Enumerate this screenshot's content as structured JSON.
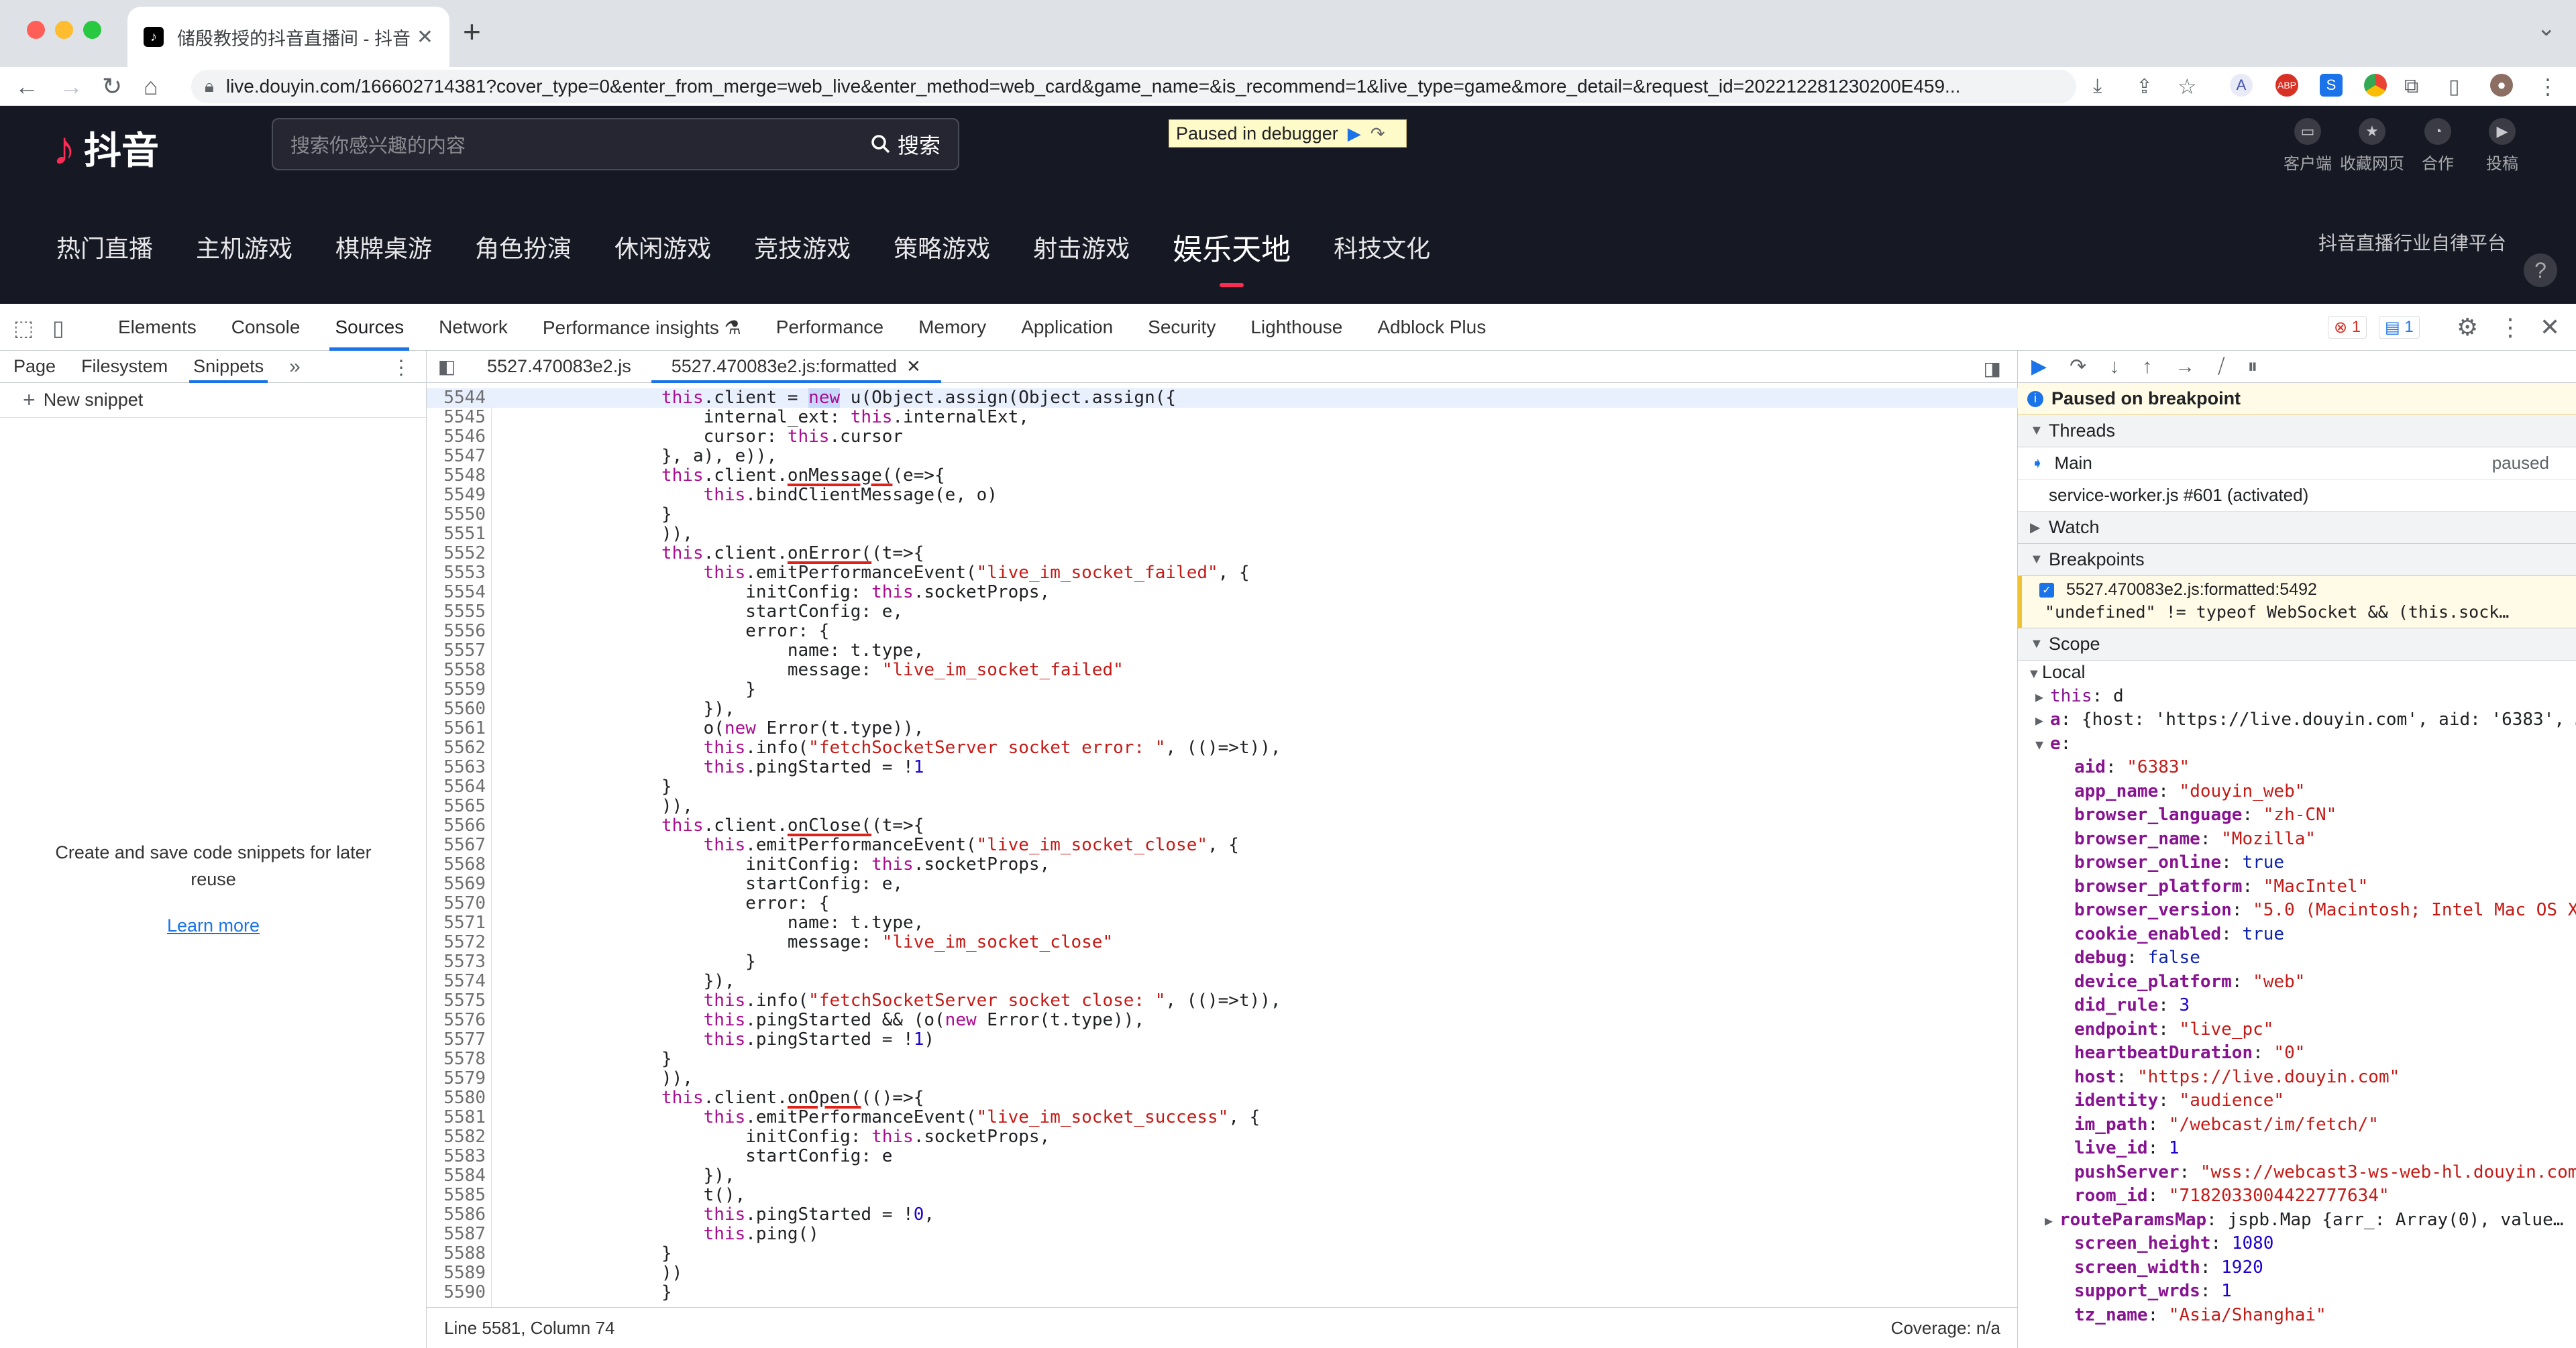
{
  "browser": {
    "tab_title": "储殷教授的抖音直播间 - 抖音直",
    "tab_close": "✕",
    "new_tab": "+",
    "url": "live.douyin.com/166602714381?cover_type=0&enter_from_merge=web_live&enter_method=web_card&game_name=&is_recommend=1&live_type=game&more_detail=&request_id=20221228123020​0E459..."
  },
  "douyin": {
    "logo_text": "抖音",
    "search_placeholder": "搜索你感兴趣的内容",
    "search_button": "搜索",
    "debugger_banner": "Paused in debugger",
    "top_tools": [
      {
        "label": "客户端",
        "icon": "monitor-icon"
      },
      {
        "label": "收藏网页",
        "icon": "star-icon"
      },
      {
        "label": "合作",
        "icon": "handshake-icon"
      },
      {
        "label": "投稿",
        "icon": "upload-icon"
      }
    ],
    "categories": [
      "热门直播",
      "主机游戏",
      "棋牌桌游",
      "角色扮演",
      "休闲游戏",
      "竞技游戏",
      "策略游戏",
      "射击游戏",
      "娱乐天地",
      "科技文化"
    ],
    "active_category": "娱乐天地",
    "right_link": "抖音直播行业自律平台",
    "help": "?"
  },
  "devtools": {
    "tabs": [
      "Elements",
      "Console",
      "Sources",
      "Network",
      "Performance insights ⚗",
      "Performance",
      "Memory",
      "Application",
      "Security",
      "Lighthouse",
      "Adblock Plus"
    ],
    "active_tab": "Sources",
    "error_count": "1",
    "message_count": "1",
    "left_tabs": [
      "Page",
      "Filesystem",
      "Snippets"
    ],
    "left_more": "»",
    "new_snippet": "New snippet",
    "empty_text": "Create and save code snippets for later reuse",
    "learn_more": "Learn more",
    "editor_tabs": [
      "5527.470083e2.js",
      "5527.470083e2.js:formatted"
    ],
    "status_left": "Line 5581, Column 74",
    "status_right": "Coverage: n/a",
    "paused_notice": "Paused on breakpoint",
    "threads_header": "Threads",
    "thread_main": "Main",
    "thread_main_state": "paused",
    "thread_worker": "service-worker.js #601 (activated)",
    "watch_header": "Watch",
    "breakpoints_header": "Breakpoints",
    "breakpoint_file": "5527.470083e2.js:formatted:5492",
    "breakpoint_code": "\"undefined\" != typeof WebSocket && (this.sock…",
    "scope_header": "Scope",
    "local_header": "Local"
  },
  "code_lines": [
    {
      "num": "5544",
      "html": "<span class=\"k\">this</span>.client = <span class=\"k hl\">new</span> u(Object.assign(Object.assign({"
    },
    {
      "num": "5545",
      "html": "    internal_ext: <span class=\"k\">this</span>.internalExt,"
    },
    {
      "num": "5546",
      "html": "    cursor: <span class=\"k\">this</span>.cursor"
    },
    {
      "num": "5547",
      "html": "}, a), e)),"
    },
    {
      "num": "5548",
      "html": "<span class=\"k\">this</span>.client.<span class=\"ul\">onMessage(</span>(e=>{"
    },
    {
      "num": "5549",
      "html": "    <span class=\"k\">this</span>.bindClientMessage(e, o)"
    },
    {
      "num": "5550",
      "html": "}"
    },
    {
      "num": "5551",
      "html": ")),"
    },
    {
      "num": "5552",
      "html": "<span class=\"k\">this</span>.client.<span class=\"ul\">onError(</span>(t=>{"
    },
    {
      "num": "5553",
      "html": "    <span class=\"k\">this</span>.emitPerformanceEvent(<span class=\"s\">\"live_im_socket_failed\"</span>, {"
    },
    {
      "num": "5554",
      "html": "        initConfig: <span class=\"k\">this</span>.socketProps,"
    },
    {
      "num": "5555",
      "html": "        startConfig: e,"
    },
    {
      "num": "5556",
      "html": "        error: {"
    },
    {
      "num": "5557",
      "html": "            name: t.type,"
    },
    {
      "num": "5558",
      "html": "            message: <span class=\"s\">\"live_im_socket_failed\"</span>"
    },
    {
      "num": "5559",
      "html": "        }"
    },
    {
      "num": "5560",
      "html": "    }),"
    },
    {
      "num": "5561",
      "html": "    o(<span class=\"k\">new</span> Error(t.type)),"
    },
    {
      "num": "5562",
      "html": "    <span class=\"k\">this</span>.info(<span class=\"s\">\"fetchSocketServer socket error: \"</span>, (()=>t)),"
    },
    {
      "num": "5563",
      "html": "    <span class=\"k\">this</span>.pingStarted = !<span class=\"n\">1</span>"
    },
    {
      "num": "5564",
      "html": "}"
    },
    {
      "num": "5565",
      "html": ")),"
    },
    {
      "num": "5566",
      "html": "<span class=\"k\">this</span>.client.<span class=\"ul\">onClose(</span>(t=>{"
    },
    {
      "num": "5567",
      "html": "    <span class=\"k\">this</span>.emitPerformanceEvent(<span class=\"s\">\"live_im_socket_close\"</span>, {"
    },
    {
      "num": "5568",
      "html": "        initConfig: <span class=\"k\">this</span>.socketProps,"
    },
    {
      "num": "5569",
      "html": "        startConfig: e,"
    },
    {
      "num": "5570",
      "html": "        error: {"
    },
    {
      "num": "5571",
      "html": "            name: t.type,"
    },
    {
      "num": "5572",
      "html": "            message: <span class=\"s\">\"live_im_socket_close\"</span>"
    },
    {
      "num": "5573",
      "html": "        }"
    },
    {
      "num": "5574",
      "html": "    }),"
    },
    {
      "num": "5575",
      "html": "    <span class=\"k\">this</span>.info(<span class=\"s\">\"fetchSocketServer socket close: \"</span>, (()=>t)),"
    },
    {
      "num": "5576",
      "html": "    <span class=\"k\">this</span>.pingStarted &amp;&amp; (o(<span class=\"k\">new</span> Error(t.type)),"
    },
    {
      "num": "5577",
      "html": "    <span class=\"k\">this</span>.pingStarted = !<span class=\"n\">1</span>)"
    },
    {
      "num": "5578",
      "html": "}"
    },
    {
      "num": "5579",
      "html": ")),"
    },
    {
      "num": "5580",
      "html": "<span class=\"k\">this</span>.client.<span class=\"ul\">onOpen(</span>(()=>{"
    },
    {
      "num": "5581",
      "html": "    <span class=\"k\">this</span>.emitPerformanceEvent(<span class=\"s\">\"live_im_socket_success\"</span>, {"
    },
    {
      "num": "5582",
      "html": "        initConfig: <span class=\"k\">this</span>.socketProps,"
    },
    {
      "num": "5583",
      "html": "        startConfig: e"
    },
    {
      "num": "5584",
      "html": "    }),"
    },
    {
      "num": "5585",
      "html": "    t(),"
    },
    {
      "num": "5586",
      "html": "    <span class=\"k\">this</span>.pingStarted = !<span class=\"n\">0</span>,"
    },
    {
      "num": "5587",
      "html": "    <span class=\"k\">this</span>.ping()"
    },
    {
      "num": "5588",
      "html": "}"
    },
    {
      "num": "5589",
      "html": "))"
    },
    {
      "num": "5590",
      "html": "}"
    }
  ],
  "scope_lines": [
    {
      "tri": "▶",
      "key": "this",
      "val": "d",
      "cls": "vo"
    },
    {
      "tri": "▶",
      "key": "a",
      "val": "{host: 'https://live.douyin.com', aid: '6383', …}",
      "cls": "vo"
    },
    {
      "tri": "▼",
      "key": "e",
      "val": "",
      "cls": "vo"
    },
    {
      "tri": "",
      "key": "aid",
      "val": "\"6383\"",
      "cls": "vs"
    },
    {
      "tri": "",
      "key": "app_name",
      "val": "\"douyin_web\"",
      "cls": "vs"
    },
    {
      "tri": "",
      "key": "browser_language",
      "val": "\"zh-CN\"",
      "cls": "vs"
    },
    {
      "tri": "",
      "key": "browser_name",
      "val": "\"Mozilla\"",
      "cls": "vs"
    },
    {
      "tri": "",
      "key": "browser_online",
      "val": "true",
      "cls": "vk"
    },
    {
      "tri": "",
      "key": "browser_platform",
      "val": "\"MacIntel\"",
      "cls": "vs"
    },
    {
      "tri": "",
      "key": "browser_version",
      "val": "\"5.0 (Macintosh; Intel Mac OS X…",
      "cls": "vs"
    },
    {
      "tri": "",
      "key": "cookie_enabled",
      "val": "true",
      "cls": "vk"
    },
    {
      "tri": "",
      "key": "debug",
      "val": "false",
      "cls": "vk"
    },
    {
      "tri": "",
      "key": "device_platform",
      "val": "\"web\"",
      "cls": "vs"
    },
    {
      "tri": "",
      "key": "did_rule",
      "val": "3",
      "cls": "vn"
    },
    {
      "tri": "",
      "key": "endpoint",
      "val": "\"live_pc\"",
      "cls": "vs"
    },
    {
      "tri": "",
      "key": "heartbeatDuration",
      "val": "\"0\"",
      "cls": "vs"
    },
    {
      "tri": "",
      "key": "host",
      "val": "\"https://live.douyin.com\"",
      "cls": "vs"
    },
    {
      "tri": "",
      "key": "identity",
      "val": "\"audience\"",
      "cls": "vs"
    },
    {
      "tri": "",
      "key": "im_path",
      "val": "\"/webcast/im/fetch/\"",
      "cls": "vs"
    },
    {
      "tri": "",
      "key": "live_id",
      "val": "1",
      "cls": "vn"
    },
    {
      "tri": "",
      "key": "pushServer",
      "val": "\"wss://webcast3-ws-web-hl.douyin.com…",
      "cls": "vs"
    },
    {
      "tri": "",
      "key": "room_id",
      "val": "\"7182033004422777634\"",
      "cls": "vs"
    },
    {
      "tri": "▶",
      "key": "routeParamsMap",
      "val": "jspb.Map {arr_: Array(0), value…",
      "cls": "vo"
    },
    {
      "tri": "",
      "key": "screen_height",
      "val": "1080",
      "cls": "vn"
    },
    {
      "tri": "",
      "key": "screen_width",
      "val": "1920",
      "cls": "vn"
    },
    {
      "tri": "",
      "key": "support_wrds",
      "val": "1",
      "cls": "vn"
    },
    {
      "tri": "",
      "key": "tz_name",
      "val": "\"Asia/Shanghai\"",
      "cls": "vs"
    }
  ]
}
